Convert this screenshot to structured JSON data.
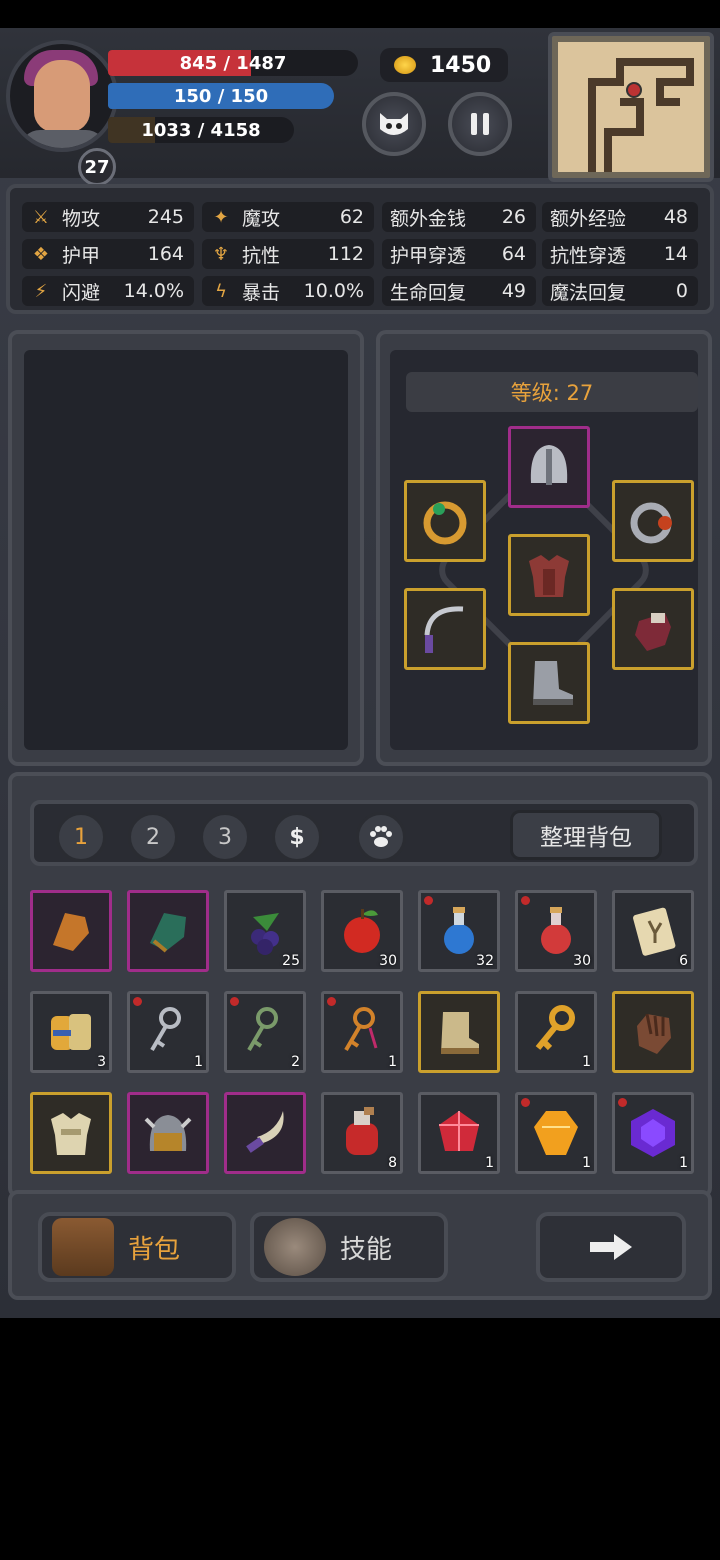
{
  "hud": {
    "level": "27",
    "hp_text": "845 / 1487",
    "mp_text": "150 / 150",
    "xp_text": "1033 / 4158",
    "gold": "1450"
  },
  "stats": [
    {
      "label": "物攻",
      "value": "245",
      "icon": "sword-icon"
    },
    {
      "label": "魔攻",
      "value": "62",
      "icon": "magic-hat-icon"
    },
    {
      "label": "额外金钱",
      "value": "26"
    },
    {
      "label": "额外经验",
      "value": "48"
    },
    {
      "label": "护甲",
      "value": "164",
      "icon": "paw-shield-icon"
    },
    {
      "label": "抗性",
      "value": "112",
      "icon": "resist-icon"
    },
    {
      "label": "护甲穿透",
      "value": "64"
    },
    {
      "label": "抗性穿透",
      "value": "14"
    },
    {
      "label": "闪避",
      "value": "14.0%",
      "icon": "running-icon"
    },
    {
      "label": "暴击",
      "value": "10.0%",
      "icon": "lightning-icon"
    },
    {
      "label": "生命回复",
      "value": "49"
    },
    {
      "label": "魔法回复",
      "value": "0"
    }
  ],
  "equipment": {
    "level_label": "等级: 27"
  },
  "inventory": {
    "tabs": [
      "1",
      "2",
      "3",
      "$"
    ],
    "sort_label": "整理背包",
    "items": [
      {
        "name": "gauntlet",
        "qty": "",
        "border": "purple",
        "dot": false
      },
      {
        "name": "green-gauntlet",
        "qty": "",
        "border": "purple",
        "dot": false
      },
      {
        "name": "berries",
        "qty": "25",
        "border": "gray",
        "dot": false
      },
      {
        "name": "apple",
        "qty": "30",
        "border": "gray",
        "dot": false
      },
      {
        "name": "blue-potion",
        "qty": "32",
        "border": "gray",
        "dot": true
      },
      {
        "name": "red-potion",
        "qty": "30",
        "border": "gray",
        "dot": true
      },
      {
        "name": "rune-scroll",
        "qty": "6",
        "border": "gray",
        "dot": false
      },
      {
        "name": "scroll-bundle",
        "qty": "3",
        "border": "gray",
        "dot": false
      },
      {
        "name": "silver-key",
        "qty": "1",
        "border": "gray",
        "dot": true
      },
      {
        "name": "green-key",
        "qty": "2",
        "border": "gray",
        "dot": true
      },
      {
        "name": "orange-key",
        "qty": "1",
        "border": "gray",
        "dot": true
      },
      {
        "name": "cloth-boots",
        "qty": "",
        "border": "gold",
        "dot": false
      },
      {
        "name": "gold-key",
        "qty": "1",
        "border": "gray",
        "dot": false
      },
      {
        "name": "leather-glove",
        "qty": "",
        "border": "gold",
        "dot": false
      },
      {
        "name": "cloth-armor",
        "qty": "",
        "border": "gold",
        "dot": false
      },
      {
        "name": "horned-helmet",
        "qty": "",
        "border": "purple",
        "dot": false
      },
      {
        "name": "curved-dagger",
        "qty": "",
        "border": "purple",
        "dot": false
      },
      {
        "name": "red-flask",
        "qty": "8",
        "border": "gray",
        "dot": false
      },
      {
        "name": "red-gem",
        "qty": "1",
        "border": "gray",
        "dot": false
      },
      {
        "name": "orange-gem",
        "qty": "1",
        "border": "gray",
        "dot": true
      },
      {
        "name": "purple-gem",
        "qty": "1",
        "border": "gray",
        "dot": true
      }
    ]
  },
  "nav": {
    "bag_label": "背包",
    "skill_label": "技能"
  }
}
